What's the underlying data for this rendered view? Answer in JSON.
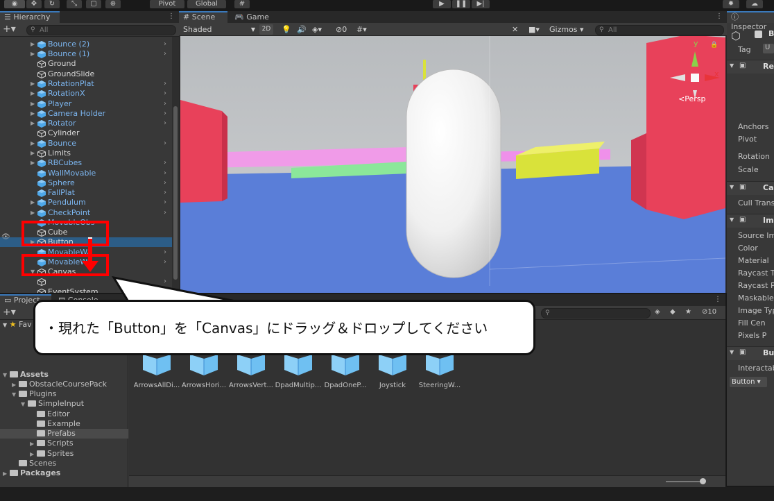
{
  "toolbar": {
    "pivot_label": "Pivot",
    "global_label": "Global"
  },
  "hierarchy": {
    "tab_label": "Hierarchy",
    "search_placeholder": "All",
    "items": [
      {
        "label": "Bounce (2)",
        "prefab": true,
        "expandable": true,
        "child": true
      },
      {
        "label": "Bounce (1)",
        "prefab": true,
        "expandable": true,
        "child": true
      },
      {
        "label": "Ground",
        "prefab": false,
        "expandable": false,
        "child": false
      },
      {
        "label": "GroundSlide",
        "prefab": false,
        "expandable": false,
        "child": false
      },
      {
        "label": "RotationPlat",
        "prefab": true,
        "expandable": true,
        "child": true
      },
      {
        "label": "RotationX",
        "prefab": true,
        "expandable": true,
        "child": true
      },
      {
        "label": "Player",
        "prefab": true,
        "expandable": true,
        "child": true
      },
      {
        "label": "Camera Holder",
        "prefab": true,
        "expandable": true,
        "child": true
      },
      {
        "label": "Rotator",
        "prefab": true,
        "expandable": true,
        "child": true
      },
      {
        "label": "Cylinder",
        "prefab": false,
        "expandable": false,
        "child": false
      },
      {
        "label": "Bounce",
        "prefab": true,
        "expandable": true,
        "child": true
      },
      {
        "label": "Limits",
        "prefab": false,
        "expandable": true,
        "child": false
      },
      {
        "label": "RBCubes",
        "prefab": true,
        "expandable": true,
        "child": true
      },
      {
        "label": "WallMovable",
        "prefab": true,
        "expandable": false,
        "child": true
      },
      {
        "label": "Sphere",
        "prefab": true,
        "expandable": false,
        "child": true
      },
      {
        "label": "FallPlat",
        "prefab": true,
        "expandable": false,
        "child": true
      },
      {
        "label": "Pendulum",
        "prefab": true,
        "expandable": true,
        "child": true
      },
      {
        "label": "CheckPoint",
        "prefab": true,
        "expandable": true,
        "child": true
      },
      {
        "label": "MovableObs",
        "prefab": true,
        "expandable": false,
        "child": false
      },
      {
        "label": "Cube",
        "prefab": false,
        "expandable": false,
        "child": false
      },
      {
        "label": "Button",
        "prefab": false,
        "expandable": true,
        "child": false,
        "selected": true
      },
      {
        "label": "MovableWa",
        "prefab": true,
        "expandable": false,
        "child": true
      },
      {
        "label": "MovableWa",
        "prefab": true,
        "expandable": false,
        "child": true
      },
      {
        "label": "Canvas",
        "prefab": false,
        "expandable": true,
        "child": false,
        "expanded": true
      },
      {
        "label": "",
        "prefab": false,
        "expandable": false,
        "child": true
      },
      {
        "label": "EventSystem",
        "prefab": false,
        "expandable": false,
        "child": false
      }
    ]
  },
  "scene": {
    "tabs": [
      "Scene",
      "Game"
    ],
    "shading_mode": "Shaded",
    "mode_2d": "2D",
    "hidden_count": "0",
    "gizmos_label": "Gizmos",
    "search_placeholder": "All",
    "persp_label": "Persp",
    "axis_y": "y",
    "axis_x": "x"
  },
  "inspector": {
    "tab_label": "Inspector",
    "tag_label": "Tag",
    "tag_value": "U",
    "name_initial": "B",
    "rows": [
      "Rec",
      "Anchors",
      "Pivot",
      "Rotation",
      "Scale",
      "Ca",
      "Cull Trans",
      "Ima",
      "Source Im",
      "Color",
      "Material",
      "Raycast T",
      "Raycast P",
      "Maskable",
      "Image Typ",
      "Fill Cen",
      "Pixels P",
      "But",
      "Interactab"
    ],
    "dropdown": "Button"
  },
  "project": {
    "tabs": [
      "Project",
      "Console"
    ],
    "favorites_label": "Fav",
    "tree": [
      {
        "label": "Assets",
        "depth": 0,
        "expanded": true
      },
      {
        "label": "ObstacleCoursePack",
        "depth": 1,
        "expanded": false
      },
      {
        "label": "Plugins",
        "depth": 1,
        "expanded": true
      },
      {
        "label": "SimpleInput",
        "depth": 2,
        "expanded": true
      },
      {
        "label": "Editor",
        "depth": 3
      },
      {
        "label": "Example",
        "depth": 3
      },
      {
        "label": "Prefabs",
        "depth": 3,
        "selected": true
      },
      {
        "label": "Scripts",
        "depth": 3,
        "expandable": true
      },
      {
        "label": "Sprites",
        "depth": 3,
        "expandable": true
      },
      {
        "label": "Scenes",
        "depth": 1
      },
      {
        "label": "Packages",
        "depth": 0,
        "expanded": false
      }
    ],
    "assets": [
      "ArrowsAllDi...",
      "ArrowsHori...",
      "ArrowsVert...",
      "DpadMultip...",
      "DpadOneP...",
      "Joystick",
      "SteeringW..."
    ],
    "hidden_count": "10"
  },
  "callout": {
    "text": "・現れた「Button」を「Canvas」にドラッグ＆ドロップしてください"
  },
  "colors": {
    "annotation_red": "#ff0000",
    "selection_blue": "#2c5d87",
    "prefab_blue": "#7cb6f0",
    "viewport_sky": "#bdbfc2",
    "floor_blue": "#5a7ed8",
    "pink_block": "#e8415a",
    "yellow_block": "#d9e23a"
  }
}
